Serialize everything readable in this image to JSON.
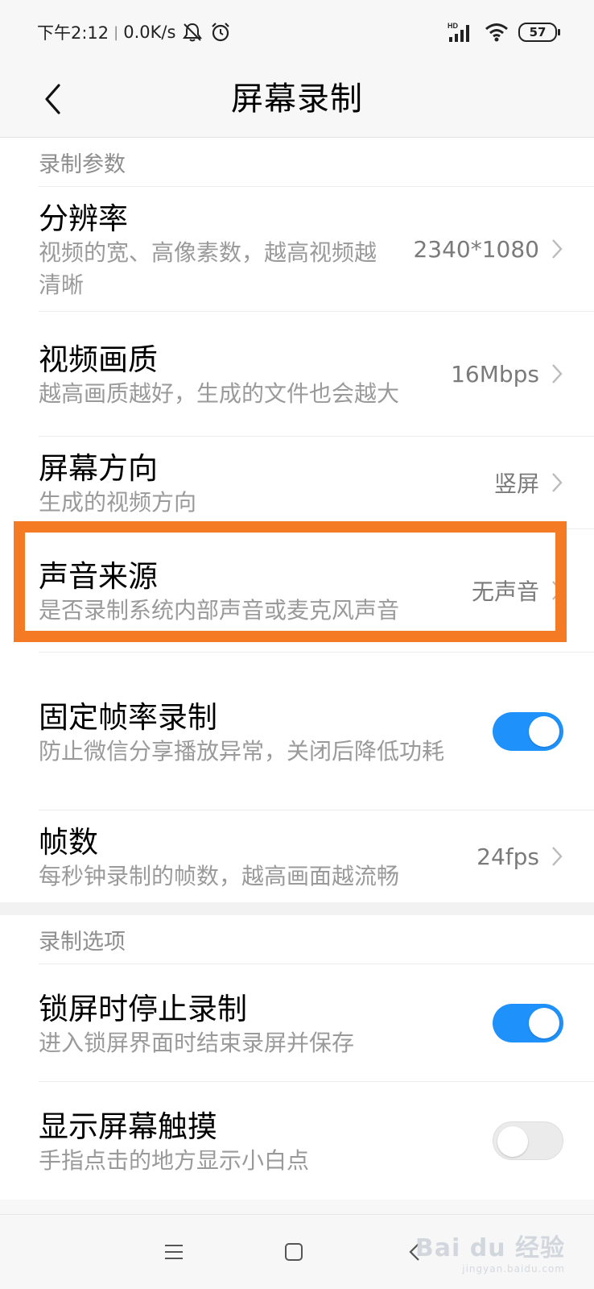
{
  "status_bar": {
    "time": "下午2:12",
    "separator": "|",
    "net_speed": "0.0K/s",
    "battery": "57",
    "signal_label": "HD",
    "icons": [
      "mute-bell-icon",
      "alarm-clock-icon",
      "signal-icon",
      "wifi-icon",
      "battery-icon"
    ]
  },
  "header": {
    "title": "屏幕录制",
    "back_icon": "chevron-left-icon"
  },
  "sections": [
    {
      "header": "录制参数",
      "rows": [
        {
          "title": "分辨率",
          "desc": "视频的宽、高像素数，越高视频越清晰",
          "value": "2340*1080"
        },
        {
          "title": "视频画质",
          "desc": "越高画质越好，生成的文件也会越大",
          "value": "16Mbps"
        },
        {
          "title": "屏幕方向",
          "desc": "生成的视频方向",
          "value": "竖屏"
        },
        {
          "title": "声音来源",
          "desc": "是否录制系统内部声音或麦克风声音",
          "value": "无声音"
        },
        {
          "title": "固定帧率录制",
          "desc": "防止微信分享播放异常，关闭后降低功耗",
          "toggle": true
        },
        {
          "title": "帧数",
          "desc": "每秒钟录制的帧数，越高画面越流畅",
          "value": "24fps"
        }
      ]
    },
    {
      "header": "录制选项",
      "rows": [
        {
          "title": "锁屏时停止录制",
          "desc": "进入锁屏界面时结束录屏并保存",
          "toggle": true
        },
        {
          "title": "显示屏幕触摸",
          "desc": "手指点击的地方显示小白点",
          "toggle": false
        }
      ]
    }
  ],
  "nav_bar": {
    "icons": [
      "menu-icon",
      "home-icon",
      "back-icon"
    ]
  },
  "watermark": {
    "text": "Bai du 经验",
    "sub": "jingyan.baidu.com"
  },
  "colors": {
    "accent": "#1f91fb",
    "highlight": "#f57a24"
  }
}
